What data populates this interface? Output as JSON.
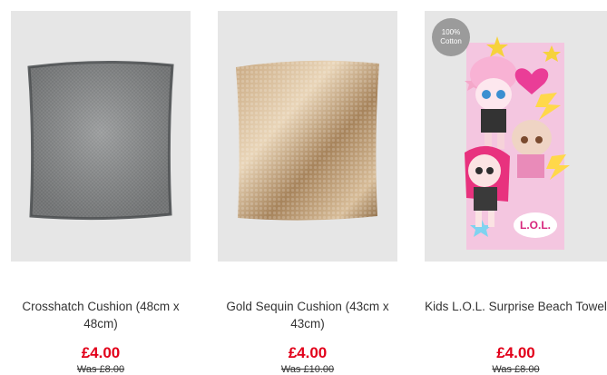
{
  "products": [
    {
      "name": "Crosshatch Cushion (48cm x 48cm)",
      "price": "£4.00",
      "was_price": "Was £8.00",
      "colors": {
        "bg": "#e6e6e6",
        "main": "#8e9091",
        "piping": "#5f6264"
      }
    },
    {
      "name": "Gold Sequin Cushion (43cm x 43cm)",
      "price": "£4.00",
      "was_price": "Was £10.00",
      "colors": {
        "bg": "#e6e6e6",
        "main": "#b5946f",
        "highlight": "#e9d5b8"
      }
    },
    {
      "name": "Kids L.O.L. Surprise Beach Towel",
      "price": "£4.00",
      "was_price": "Was £8.00",
      "badge": {
        "line1": "100%",
        "line2": "Cotton"
      },
      "colors": {
        "bg": "#e6e6e6",
        "towel": "#f4c6e0",
        "badge": "#9b9b9b"
      }
    }
  ],
  "price_color": "#e2001a"
}
